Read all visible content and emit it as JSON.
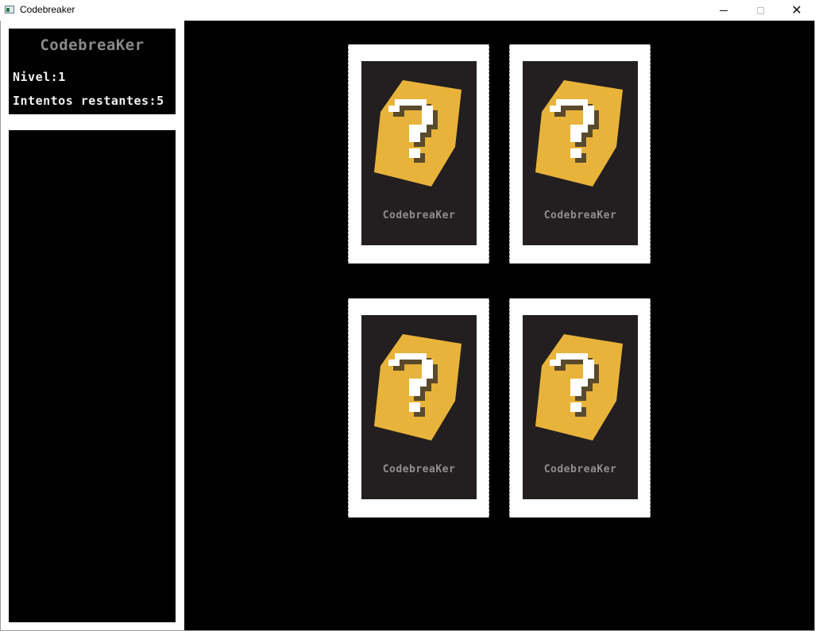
{
  "window": {
    "title": "Codebreaker",
    "controls": [
      "minimize-icon",
      "maximize-icon",
      "close-icon"
    ],
    "close_glyph": "✕"
  },
  "info": {
    "game_title": "CodebreaKer",
    "level_label": "Nivel:",
    "level_value": "1",
    "attempts_label": "Intentos restantes:",
    "attempts_value": "5"
  },
  "cards": [
    {
      "brand": "CodebreaKer",
      "face": "question-mark-icon",
      "state": "face-down"
    },
    {
      "brand": "CodebreaKer",
      "face": "question-mark-icon",
      "state": "face-down"
    },
    {
      "brand": "CodebreaKer",
      "face": "question-mark-icon",
      "state": "face-down"
    },
    {
      "brand": "CodebreaKer",
      "face": "question-mark-icon",
      "state": "face-down"
    }
  ],
  "colors": {
    "board_bg": "#000000",
    "card_bg": "#231f20",
    "hexagon": "#e8b33a",
    "question_mark": "#ffffff",
    "question_shadow": "#5a4a2c",
    "title_gray": "#8a8a8a",
    "stat_text": "#f2f2f2"
  }
}
